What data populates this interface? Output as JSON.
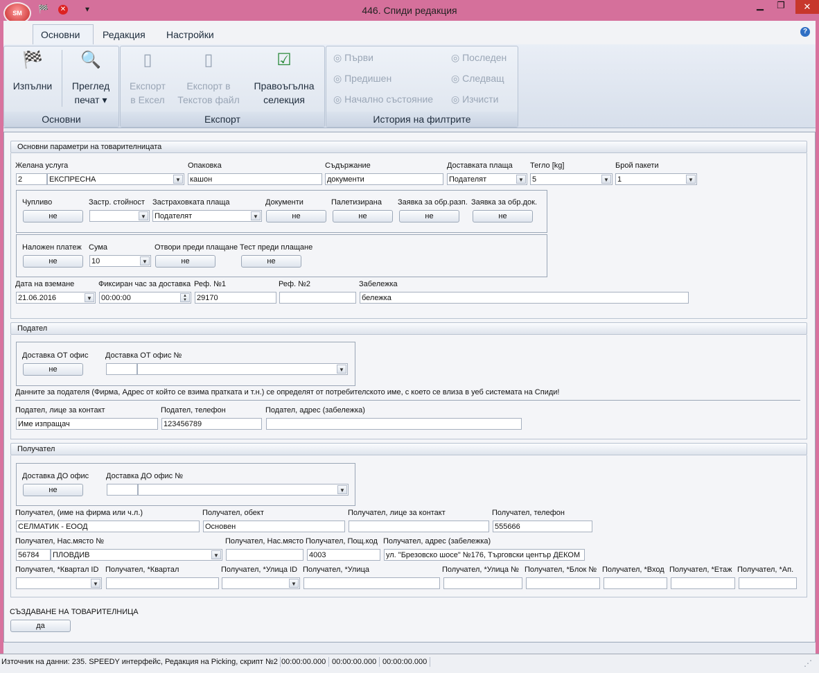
{
  "window": {
    "title": "446. Спиди редакция",
    "logo": "SM"
  },
  "ribbon": {
    "tabs": [
      "Основни",
      "Редакция",
      "Настройки"
    ],
    "main_group": {
      "title": "Основни",
      "run": "Изпълни",
      "preview": "Преглед",
      "preview2": "печат ▾"
    },
    "export_group": {
      "title": "Експорт",
      "excel1": "Експорт",
      "excel2": "в Ексел",
      "text1": "Експорт в",
      "text2": "Текстов файл",
      "rect1": "Правоъгълна",
      "rect2": "селекция"
    },
    "history_group": {
      "title": "История на филтрите",
      "first": "Първи",
      "last": "Последен",
      "prev": "Предишен",
      "next": "Следващ",
      "initial": "Начално състояние",
      "clear": "Изчисти"
    }
  },
  "params": {
    "header": "Основни параметри на товарителницата",
    "labels": {
      "service": "Желана услуга",
      "packing": "Опаковка",
      "content": "Съдържание",
      "payer": "Доставката плаща",
      "weight": "Тегло [kg]",
      "packets": "Брой пакети"
    },
    "values": {
      "service_id": "2",
      "service": "ЕКСПРЕСНА",
      "packing": "кашон",
      "content": "документи",
      "payer": "Подателят",
      "weight": "5",
      "packets": "1"
    },
    "box1": {
      "labels": {
        "fragile": "Чупливо",
        "insured": "Застр. стойност",
        "ins_payer": "Застраховката плаща",
        "documents": "Документи",
        "pallet": "Палетизирана",
        "req_pkg": "Заявка за обр.разп.",
        "req_doc": "Заявка за обр.док."
      },
      "values": {
        "fragile": "не",
        "insured": "",
        "ins_payer": "Подателят",
        "documents": "не",
        "pallet": "не",
        "req_pkg": "не",
        "req_doc": "не"
      }
    },
    "box2": {
      "labels": {
        "cod": "Наложен платеж",
        "sum": "Сума",
        "open": "Отвори преди плащане",
        "test": "Тест преди плащане"
      },
      "values": {
        "cod": "не",
        "sum": "10",
        "open": "не",
        "test": "не"
      }
    },
    "labels2": {
      "date": "Дата на вземане",
      "time": "Фиксиран час за доставка",
      "ref1": "Реф. №1",
      "ref2": "Реф. №2",
      "note": "Забележка"
    },
    "values2": {
      "date": "21.06.2016",
      "time": "00:00:00",
      "ref1": "29170",
      "ref2": "",
      "note": "бележка"
    }
  },
  "sender": {
    "header": "Подател",
    "labels": {
      "from_office": "Доставка ОТ офис",
      "office_no": "Доставка ОТ офис №",
      "contact": "Подател, лице за контакт",
      "phone": "Подател, телефон",
      "address": "Подател, адрес (забележка)"
    },
    "values": {
      "from_office": "не",
      "office_id": "",
      "office": "",
      "contact": "Име изпращач",
      "phone": "123456789",
      "address": ""
    },
    "info": "Данните за подателя (Фирма, Адрес от който се взима пратката и т.н.) се определят от потребителското име, с което се влиза в уеб системата на Спиди!"
  },
  "recipient": {
    "header": "Получател",
    "labels": {
      "to_office": "Доставка ДО офис",
      "office_no": "Доставка ДО офис №",
      "name": "Получател, (име на фирма или ч.л.)",
      "object": "Получател, обект",
      "contact": "Получател, лице за контакт",
      "phone": "Получател, телефон",
      "city_no": "Получател, Нас.място №",
      "city": "Получател, Нас.място",
      "post": "Получател, Пощ.код",
      "address": "Получател, адрес (забележка)",
      "quarter_id": "Получател, *Квартал ID",
      "quarter": "Получател, *Квартал",
      "street_id": "Получател, *Улица ID",
      "street": "Получател, *Улица",
      "street_no": "Получател, *Улица №",
      "block": "Получател, *Блок №",
      "entrance": "Получател, *Вход",
      "floor": "Получател, *Етаж",
      "apt": "Получател, *Ап."
    },
    "values": {
      "to_office": "не",
      "office_id": "",
      "office": "",
      "name": "СЕЛМАТИК - ЕООД",
      "object": "Основен",
      "contact": "",
      "phone": "555666",
      "city_no": "56784",
      "city_name": "ПЛОВДИВ",
      "city": "",
      "post": "4003",
      "address": "ул. \"Брезовско шосе\"  №176, Търговски център ДЕКОМ",
      "quarter_id": "",
      "quarter": "",
      "street_id": "",
      "street": "",
      "street_no": "",
      "block": "",
      "entrance": "",
      "floor": "",
      "apt": ""
    }
  },
  "create": {
    "label": "СЪЗДАВАНЕ НА ТОВАРИТЕЛНИЦА",
    "button": "да"
  },
  "status": {
    "source": "Източник на данни: 235. SPEEDY интерфейс, Редакция на Picking, скрипт №2 (",
    "t1": "00:00:00.000",
    "t2": "00:00:00.000",
    "t3": "00:00:00.000"
  }
}
